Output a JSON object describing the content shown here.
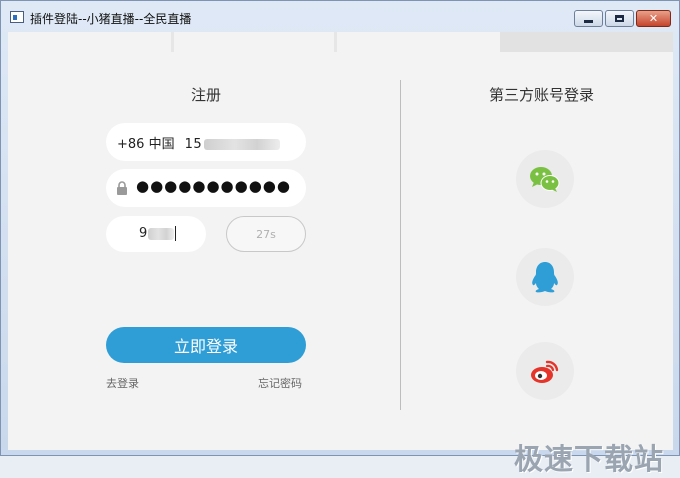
{
  "window": {
    "title": "插件登陆--小猪直播--全民直播",
    "controls": {
      "minimize": "minimize",
      "maximize": "maximize",
      "close": "✕"
    }
  },
  "register": {
    "title": "注册",
    "phone": {
      "country_code": "+86 中国",
      "number_visible": "15"
    },
    "password": {
      "masked": "●●●●●●●●●●●"
    },
    "code": {
      "visible": "9"
    },
    "countdown": "27s",
    "login_button": "立即登录",
    "go_login": "去登录",
    "forgot_password": "忘记密码"
  },
  "third_party": {
    "title": "第三方账号登录",
    "providers": [
      {
        "name": "wechat",
        "icon": "wechat-icon",
        "color": "#7ac143"
      },
      {
        "name": "qq",
        "icon": "qq-icon",
        "color": "#2f9ed6"
      },
      {
        "name": "weibo",
        "icon": "weibo-icon",
        "color": "#e5352b"
      }
    ]
  },
  "watermark": "极速下载站",
  "colors": {
    "accent": "#2f9ed6",
    "background": "#f3f3f3"
  }
}
